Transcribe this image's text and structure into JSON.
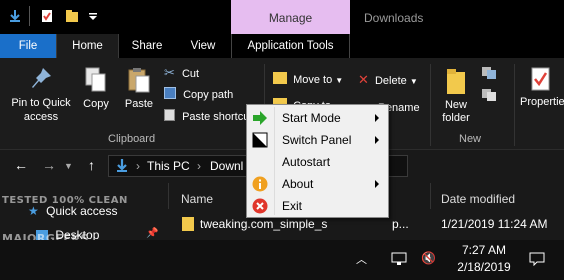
{
  "title_bar": {
    "contextual_tab": "Manage",
    "window_title": "Downloads"
  },
  "ribbon_tabs": {
    "file": "File",
    "home": "Home",
    "share": "Share",
    "view": "View",
    "app_tools": "Application Tools"
  },
  "ribbon": {
    "pin_quick_access": "Pin to Quick access",
    "copy": "Copy",
    "paste": "Paste",
    "cut": "Cut",
    "copy_path": "Copy path",
    "paste_shortcut": "Paste shortcut",
    "clipboard_group": "Clipboard",
    "move_to": "Move to",
    "copy_to": "Copy to",
    "delete": "Delete",
    "rename": "Rename",
    "new_folder": "New folder",
    "new_group": "New",
    "properties": "Properties"
  },
  "address_bar": {
    "path_root": "This PC",
    "path_leaf": "Downl"
  },
  "columns": {
    "name": "Name",
    "date_modified": "Date modified"
  },
  "sidebar": {
    "quick_access": "Quick access",
    "desktop": "Desktop"
  },
  "files": [
    {
      "name": "tweaking.com_simple_s",
      "date": "1/21/2019 11:24 AM"
    }
  ],
  "file_ext_fragment": "p...",
  "context_menu": {
    "items": [
      {
        "label": "Start Mode",
        "submenu": true,
        "icon": "green-arrow-icon"
      },
      {
        "label": "Switch Panel",
        "submenu": true,
        "icon": "switch-panel-icon"
      },
      {
        "label": "Autostart",
        "submenu": false,
        "icon": ""
      },
      {
        "label": "About",
        "submenu": true,
        "icon": "info-icon"
      },
      {
        "label": "Exit",
        "submenu": false,
        "icon": "close-red-icon"
      }
    ]
  },
  "taskbar": {
    "time": "7:27 AM",
    "date": "2/18/2019"
  },
  "watermark": {
    "line1": "TESTED 100% CLEAN",
    "line2": "MAJORGEEKS"
  },
  "colors": {
    "file_tab": "#1a6fc9",
    "manage_tab": "#e6bdf0",
    "menu_bg": "#f0f0f0"
  }
}
